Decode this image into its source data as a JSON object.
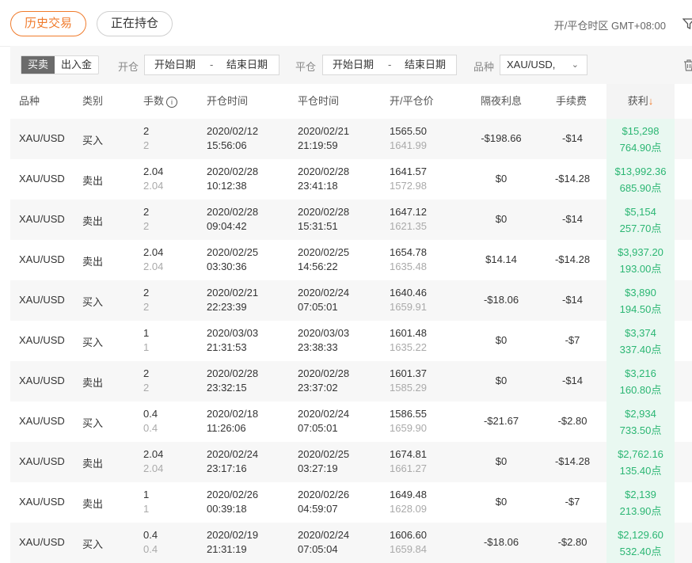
{
  "tabs": {
    "history": "历史交易",
    "positions": "正在持仓"
  },
  "timezone": "开/平仓时区 GMT+08:00",
  "filters": {
    "seg_trade": "买卖",
    "seg_funds": "出入金",
    "open_label": "开仓",
    "close_label": "平仓",
    "start_date": "开始日期",
    "dash": "-",
    "end_date": "结束日期",
    "symbol_label": "品种",
    "symbol_value": "XAU/USD,"
  },
  "headers": {
    "symbol": "品种",
    "type": "类别",
    "lots": "手数",
    "open_time": "开仓时间",
    "close_time": "平仓时间",
    "price": "开/平仓价",
    "swap": "隔夜利息",
    "fee": "手续费",
    "profit": "获利",
    "sort_arrow": "↓"
  },
  "colors": {
    "accent": "#f07b2c",
    "profit_green": "#2bb673",
    "profit_bg": "#e9f8f1"
  },
  "rows": [
    {
      "symbol": "XAU/USD",
      "type": "买入",
      "lots": "2",
      "lots2": "2",
      "open_date": "2020/02/12",
      "open_time": "15:56:06",
      "close_date": "2020/02/21",
      "close_time": "21:19:59",
      "open_price": "1565.50",
      "close_price": "1641.99",
      "swap": "-$198.66",
      "fee": "-$14",
      "profit": "$15,298",
      "points": "764.90点"
    },
    {
      "symbol": "XAU/USD",
      "type": "卖出",
      "lots": "2.04",
      "lots2": "2.04",
      "open_date": "2020/02/28",
      "open_time": "10:12:38",
      "close_date": "2020/02/28",
      "close_time": "23:41:18",
      "open_price": "1641.57",
      "close_price": "1572.98",
      "swap": "$0",
      "fee": "-$14.28",
      "profit": "$13,992.36",
      "points": "685.90点"
    },
    {
      "symbol": "XAU/USD",
      "type": "卖出",
      "lots": "2",
      "lots2": "2",
      "open_date": "2020/02/28",
      "open_time": "09:04:42",
      "close_date": "2020/02/28",
      "close_time": "15:31:51",
      "open_price": "1647.12",
      "close_price": "1621.35",
      "swap": "$0",
      "fee": "-$14",
      "profit": "$5,154",
      "points": "257.70点"
    },
    {
      "symbol": "XAU/USD",
      "type": "卖出",
      "lots": "2.04",
      "lots2": "2.04",
      "open_date": "2020/02/25",
      "open_time": "03:30:36",
      "close_date": "2020/02/25",
      "close_time": "14:56:22",
      "open_price": "1654.78",
      "close_price": "1635.48",
      "swap": "$14.14",
      "fee": "-$14.28",
      "profit": "$3,937.20",
      "points": "193.00点"
    },
    {
      "symbol": "XAU/USD",
      "type": "买入",
      "lots": "2",
      "lots2": "2",
      "open_date": "2020/02/21",
      "open_time": "22:23:39",
      "close_date": "2020/02/24",
      "close_time": "07:05:01",
      "open_price": "1640.46",
      "close_price": "1659.91",
      "swap": "-$18.06",
      "fee": "-$14",
      "profit": "$3,890",
      "points": "194.50点"
    },
    {
      "symbol": "XAU/USD",
      "type": "买入",
      "lots": "1",
      "lots2": "1",
      "open_date": "2020/03/03",
      "open_time": "21:31:53",
      "close_date": "2020/03/03",
      "close_time": "23:38:33",
      "open_price": "1601.48",
      "close_price": "1635.22",
      "swap": "$0",
      "fee": "-$7",
      "profit": "$3,374",
      "points": "337.40点"
    },
    {
      "symbol": "XAU/USD",
      "type": "卖出",
      "lots": "2",
      "lots2": "2",
      "open_date": "2020/02/28",
      "open_time": "23:32:15",
      "close_date": "2020/02/28",
      "close_time": "23:37:02",
      "open_price": "1601.37",
      "close_price": "1585.29",
      "swap": "$0",
      "fee": "-$14",
      "profit": "$3,216",
      "points": "160.80点"
    },
    {
      "symbol": "XAU/USD",
      "type": "买入",
      "lots": "0.4",
      "lots2": "0.4",
      "open_date": "2020/02/18",
      "open_time": "11:26:06",
      "close_date": "2020/02/24",
      "close_time": "07:05:01",
      "open_price": "1586.55",
      "close_price": "1659.90",
      "swap": "-$21.67",
      "fee": "-$2.80",
      "profit": "$2,934",
      "points": "733.50点"
    },
    {
      "symbol": "XAU/USD",
      "type": "卖出",
      "lots": "2.04",
      "lots2": "2.04",
      "open_date": "2020/02/24",
      "open_time": "23:17:16",
      "close_date": "2020/02/25",
      "close_time": "03:27:19",
      "open_price": "1674.81",
      "close_price": "1661.27",
      "swap": "$0",
      "fee": "-$14.28",
      "profit": "$2,762.16",
      "points": "135.40点"
    },
    {
      "symbol": "XAU/USD",
      "type": "卖出",
      "lots": "1",
      "lots2": "1",
      "open_date": "2020/02/26",
      "open_time": "00:39:18",
      "close_date": "2020/02/26",
      "close_time": "04:59:07",
      "open_price": "1649.48",
      "close_price": "1628.09",
      "swap": "$0",
      "fee": "-$7",
      "profit": "$2,139",
      "points": "213.90点"
    },
    {
      "symbol": "XAU/USD",
      "type": "买入",
      "lots": "0.4",
      "lots2": "0.4",
      "open_date": "2020/02/19",
      "open_time": "21:31:19",
      "close_date": "2020/02/24",
      "close_time": "07:05:04",
      "open_price": "1606.60",
      "close_price": "1659.84",
      "swap": "-$18.06",
      "fee": "-$2.80",
      "profit": "$2,129.60",
      "points": "532.40点"
    }
  ]
}
